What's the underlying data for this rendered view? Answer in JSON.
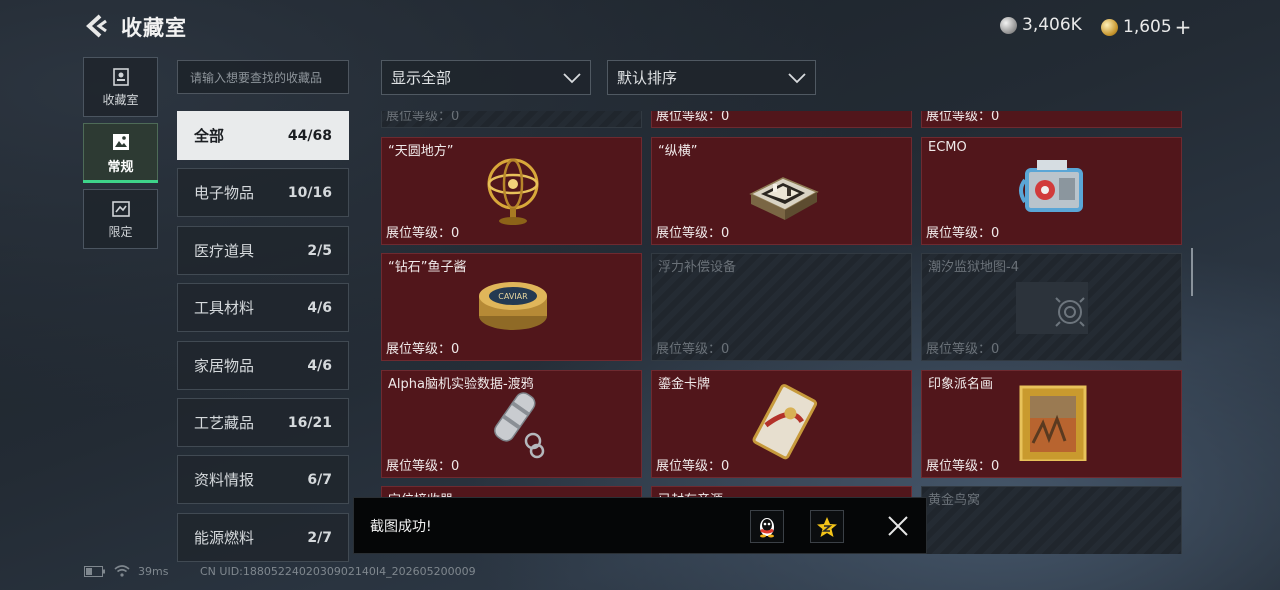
{
  "header": {
    "title": "收藏室",
    "currency_silver": "3,406K",
    "currency_gold": "1,605",
    "plus": "+"
  },
  "nav_tabs": [
    {
      "label": "收藏室",
      "icon": "display-case-icon"
    },
    {
      "label": "常规",
      "icon": "picture-icon",
      "active": true
    },
    {
      "label": "限定",
      "icon": "limited-icon"
    }
  ],
  "search": {
    "placeholder": "请输入想要查找的收藏品"
  },
  "categories": [
    {
      "name": "全部",
      "count": "44/68",
      "active": true
    },
    {
      "name": "电子物品",
      "count": "10/16"
    },
    {
      "name": "医疗道具",
      "count": "2/5"
    },
    {
      "name": "工具材料",
      "count": "4/6"
    },
    {
      "name": "家居物品",
      "count": "4/6"
    },
    {
      "name": "工艺藏品",
      "count": "16/21"
    },
    {
      "name": "资料情报",
      "count": "6/7"
    },
    {
      "name": "能源燃料",
      "count": "2/7"
    }
  ],
  "filters": {
    "display": "显示全部",
    "sort": "默认排序"
  },
  "level_label": "展位等级：0",
  "cards": [
    {
      "name": "",
      "locked": true
    },
    {
      "name": "",
      "locked": false
    },
    {
      "name": "",
      "locked": false
    },
    {
      "name": "“天圆地方”",
      "locked": false,
      "icon": "armillary-sphere-icon"
    },
    {
      "name": "“纵横”",
      "locked": false,
      "icon": "chess-box-icon"
    },
    {
      "name": "ECMO",
      "locked": false,
      "icon": "ecmo-machine-icon"
    },
    {
      "name": "“钻石”鱼子酱",
      "locked": false,
      "icon": "caviar-tin-icon"
    },
    {
      "name": "浮力补偿设备",
      "locked": true
    },
    {
      "name": "潮汐监狱地图-4",
      "locked": true,
      "icon": "map-target-icon"
    },
    {
      "name": "Alpha脑机实验数据-渡鸦",
      "locked": false,
      "icon": "data-capsule-icon"
    },
    {
      "name": "鎏金卡牌",
      "locked": false,
      "icon": "gilded-card-icon"
    },
    {
      "name": "印象派名画",
      "locked": false,
      "icon": "framed-painting-icon"
    },
    {
      "name": "定位接收器",
      "locked": false
    },
    {
      "name": "已封存音源",
      "locked": false
    },
    {
      "name": "黄金鸟窝",
      "locked": true
    }
  ],
  "toast": {
    "text": "截图成功!",
    "btn1_icon": "qq-penguin-icon",
    "btn2_icon": "star-badge-icon"
  },
  "status": {
    "ping": "39ms",
    "uid": "CN UID:1880522402030902140I4_202605200009"
  }
}
